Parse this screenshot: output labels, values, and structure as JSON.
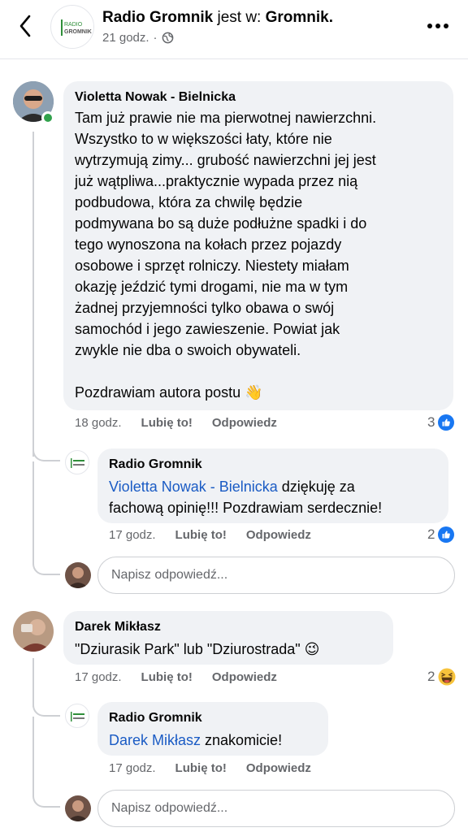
{
  "header": {
    "page_name": "Radio Gromnik",
    "is_at": "jest w:",
    "location": "Gromnik.",
    "time": "21 godz.",
    "separator": "·",
    "logo_line1": "RADIO",
    "logo_line2": "GROMNIK"
  },
  "comments": [
    {
      "author": "Violetta Nowak - Bielnicka",
      "text_lines": [
        "Tam już prawie nie ma pierwotnej nawierzchni.",
        "Wszystko to w większości łaty, które nie",
        "wytrzymują zimy... grubość nawierzchni jej jest",
        "już wątpliwa...praktycznie wypada przez nią",
        "podbudowa, która za chwilę będzie",
        "podmywana bo są duże podłużne spadki i do",
        "tego wynoszona na kołach przez pojazdy",
        "osobowe i sprzęt rolniczy.  Niestety miałam",
        "okazję jeździć tymi drogami, nie ma w tym",
        "żadnej przyjemności tylko obawa o swój",
        "samochód i jego zawieszenie.  Powiat jak",
        "zwykle nie dba o swoich obywateli."
      ],
      "closing": "Pozdrawiam autora postu",
      "closing_emoji": "👋",
      "time": "18 godz.",
      "like": "Lubię to!",
      "reply": "Odpowiedz",
      "reactions": "3",
      "reaction_icon": "like-icon",
      "replies": [
        {
          "author": "Radio Gromnik",
          "mention": "Violetta Nowak - Bielnicka",
          "text_after_mention": " dziękuję za",
          "text_line2": "fachową opinię!!! Pozdrawiam serdecznie!",
          "time": "17 godz.",
          "like": "Lubię to!",
          "reply": "Odpowiedz",
          "reactions": "2",
          "reaction_icon": "like-icon"
        }
      ],
      "reply_placeholder": "Napisz odpowiedź..."
    },
    {
      "author": "Darek Mikłasz",
      "text": "\"Dziurasik Park\" lub \"Dziurostrada\"",
      "emoji": "😉",
      "time": "17 godz.",
      "like": "Lubię to!",
      "reply": "Odpowiedz",
      "reactions": "2",
      "reaction_icon": "haha-icon",
      "replies": [
        {
          "author": "Radio Gromnik",
          "mention": "Darek Mikłasz",
          "text_after_mention": " znakomicie!",
          "time": "17 godz.",
          "like": "Lubię to!",
          "reply": "Odpowiedz"
        }
      ],
      "reply_placeholder": "Napisz odpowiedź..."
    }
  ],
  "colors": {
    "bubble": "#f0f2f5",
    "mention": "#1a5bc4",
    "like_blue": "#1877f2",
    "online": "#31a24c",
    "secondary_text": "#65676b"
  }
}
